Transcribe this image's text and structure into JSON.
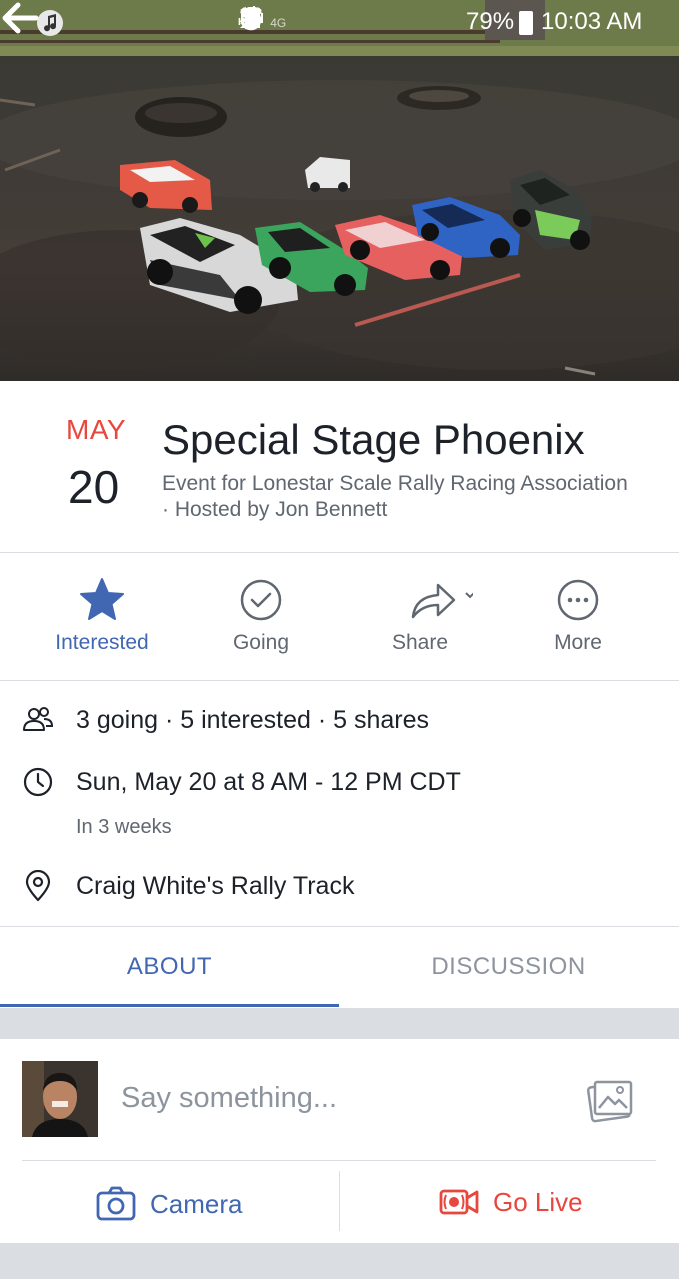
{
  "status_bar": {
    "network": "Hi-Fi",
    "lte": "4G",
    "battery": "79%",
    "time": "10:03 AM"
  },
  "event": {
    "month": "MAY",
    "day": "20",
    "title": "Special Stage Phoenix",
    "subtitle": "Event for Lonestar Scale Rally Racing Association · Hosted by Jon Bennett"
  },
  "actions": [
    {
      "label": "Interested",
      "icon": "star-icon",
      "active": true
    },
    {
      "label": "Going",
      "icon": "check-circle-icon",
      "active": false
    },
    {
      "label": "Share",
      "icon": "share-icon",
      "active": false
    },
    {
      "label": "More",
      "icon": "more-icon",
      "active": false
    }
  ],
  "details": {
    "stats": "3 going · 5 interested · 5 shares",
    "datetime": "Sun, May 20 at 8 AM - 12 PM CDT",
    "relative": "In 3 weeks",
    "location": "Craig White's Rally Track"
  },
  "tabs": {
    "about": "ABOUT",
    "discussion": "DISCUSSION"
  },
  "composer": {
    "placeholder": "Say something...",
    "camera_label": "Camera",
    "live_label": "Go Live"
  },
  "colors": {
    "accent_blue": "#4267b2",
    "live_red": "#e7473d",
    "month_red": "#e7473d"
  }
}
